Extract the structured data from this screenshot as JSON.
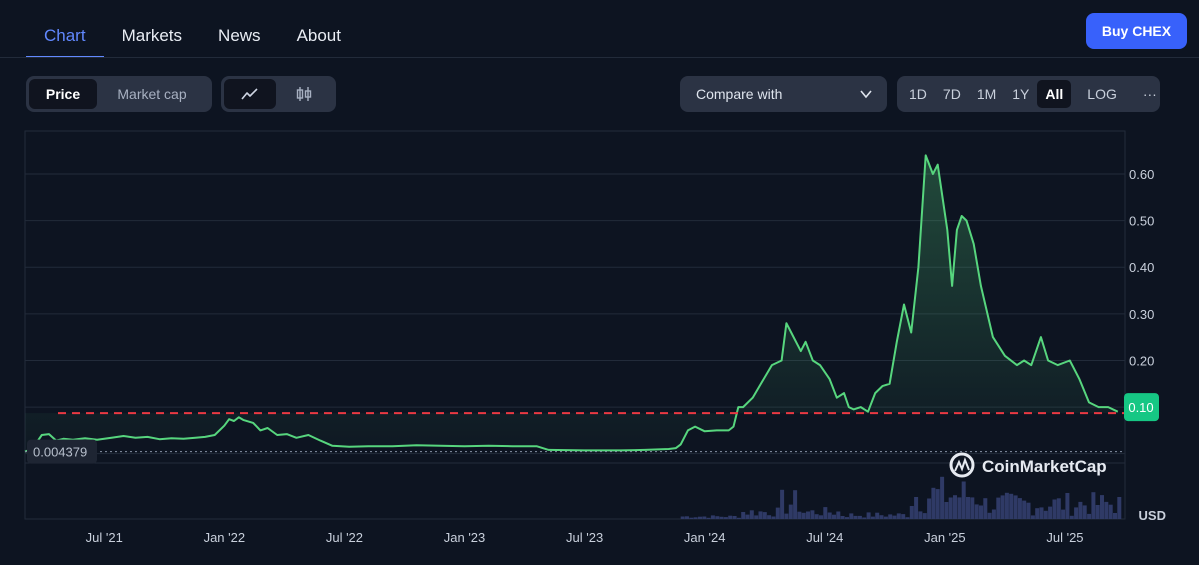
{
  "tabs": [
    {
      "label": "Chart"
    },
    {
      "label": "Markets"
    },
    {
      "label": "News"
    },
    {
      "label": "About"
    }
  ],
  "buy_button": "Buy CHEX",
  "view_toggle": {
    "price": "Price",
    "market_cap": "Market cap"
  },
  "chart_type_icons": [
    "line-chart-icon",
    "candlestick-icon"
  ],
  "compare": {
    "label": "Compare with"
  },
  "ranges": [
    "1D",
    "7D",
    "1M",
    "1Y",
    "All"
  ],
  "log_label": "LOG",
  "more_label": "···",
  "watermark": "CoinMarketCap",
  "colors": {
    "accent": "#3861fb",
    "line": "#57d67e",
    "dash": "#ea3943",
    "bg": "#0d1421"
  },
  "chart_data": {
    "type": "line",
    "title": "",
    "xlabel": "",
    "ylabel": "",
    "currency_label": "USD",
    "ylim": [
      -0.02,
      0.68
    ],
    "yticks": [
      0.1,
      0.2,
      0.3,
      0.4,
      0.5,
      0.6
    ],
    "ytick_labels": [
      "0.10",
      "0.20",
      "0.30",
      "0.40",
      "0.50",
      "0.60"
    ],
    "x_range": [
      2021.17,
      2025.75
    ],
    "xticks": [
      2021.5,
      2022.0,
      2022.5,
      2023.0,
      2023.5,
      2024.0,
      2024.5,
      2025.0,
      2025.5
    ],
    "xtick_labels": [
      "Jul '21",
      "Jan '22",
      "Jul '22",
      "Jan '23",
      "Jul '23",
      "Jan '24",
      "Jul '24",
      "Jan '25",
      "Jul '25"
    ],
    "current_price_label": "0.10",
    "reference_line": 0.087,
    "min_price_label": "0.004379",
    "min_price": 0.004379,
    "series": [
      {
        "x": [
          2021.17,
          2021.2,
          2021.24,
          2021.27,
          2021.3,
          2021.33,
          2021.37,
          2021.42,
          2021.47,
          2021.53,
          2021.58,
          2021.63,
          2021.68,
          2021.73,
          2021.78,
          2021.83,
          2021.88,
          2021.92,
          2021.96,
          2022.0,
          2022.02,
          2022.04,
          2022.06,
          2022.08,
          2022.12,
          2022.15,
          2022.18,
          2022.22,
          2022.26,
          2022.3,
          2022.35,
          2022.4,
          2022.45,
          2022.52,
          2022.6,
          2022.7,
          2022.8,
          2022.9,
          2023.0,
          2023.1,
          2023.2,
          2023.3,
          2023.35,
          2023.5,
          2023.65,
          2023.75,
          2023.85,
          2023.88,
          2023.9,
          2023.93,
          2023.96,
          2024.0,
          2024.05,
          2024.1,
          2024.12,
          2024.14,
          2024.16,
          2024.2,
          2024.24,
          2024.28,
          2024.32,
          2024.34,
          2024.36,
          2024.38,
          2024.4,
          2024.42,
          2024.45,
          2024.48,
          2024.52,
          2024.55,
          2024.58,
          2024.6,
          2024.62,
          2024.65,
          2024.68,
          2024.71,
          2024.74,
          2024.77,
          2024.8,
          2024.83,
          2024.86,
          2024.89,
          2024.92,
          2024.95,
          2024.97,
          2024.99,
          2025.01,
          2025.03,
          2025.05,
          2025.07,
          2025.09,
          2025.12,
          2025.15,
          2025.2,
          2025.25,
          2025.3,
          2025.33,
          2025.36,
          2025.4,
          2025.43,
          2025.47,
          2025.52,
          2025.56,
          2025.6,
          2025.64,
          2025.68,
          2025.72
        ],
        "values": [
          0.004379,
          0.01,
          0.04,
          0.042,
          0.028,
          0.032,
          0.03,
          0.033,
          0.03,
          0.034,
          0.038,
          0.034,
          0.036,
          0.031,
          0.033,
          0.032,
          0.034,
          0.036,
          0.04,
          0.06,
          0.074,
          0.07,
          0.078,
          0.072,
          0.066,
          0.05,
          0.055,
          0.04,
          0.042,
          0.034,
          0.04,
          0.028,
          0.017,
          0.015,
          0.016,
          0.016,
          0.018,
          0.017,
          0.016,
          0.017,
          0.016,
          0.016,
          0.008,
          0.007,
          0.007,
          0.008,
          0.01,
          0.012,
          0.02,
          0.05,
          0.058,
          0.048,
          0.05,
          0.05,
          0.058,
          0.1,
          0.1,
          0.12,
          0.155,
          0.19,
          0.2,
          0.28,
          0.26,
          0.24,
          0.22,
          0.24,
          0.2,
          0.19,
          0.16,
          0.12,
          0.13,
          0.1,
          0.095,
          0.1,
          0.09,
          0.13,
          0.145,
          0.15,
          0.24,
          0.32,
          0.26,
          0.4,
          0.64,
          0.6,
          0.62,
          0.55,
          0.48,
          0.36,
          0.48,
          0.51,
          0.5,
          0.45,
          0.36,
          0.25,
          0.21,
          0.19,
          0.2,
          0.19,
          0.25,
          0.2,
          0.19,
          0.2,
          0.16,
          0.11,
          0.1,
          0.1,
          0.09
        ]
      }
    ]
  }
}
